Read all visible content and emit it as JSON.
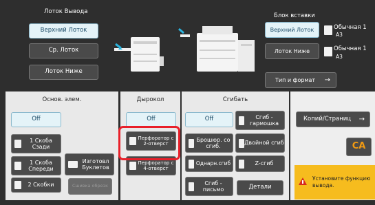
{
  "output_tray": {
    "title": "Лоток Вывода",
    "upper_tray": "Верхний Лоток",
    "middle_tray": "Ср. Лоток",
    "lower_tray": "Лоток Ниже"
  },
  "insert_unit": {
    "title": "Блок вставки",
    "upper_tray": "Верхний Лоток",
    "lower_tray": "Лоток Ниже",
    "upper_paper_type": "Обычная 1",
    "upper_paper_size": "A3",
    "lower_paper_type": "Обычная 1",
    "lower_paper_size": "A3",
    "type_size_button": "Тип и формат",
    "type_size_arrow": "→"
  },
  "basic": {
    "header": "Основ. элем.",
    "off": "Off",
    "staple_back": "1 Скоба Сзади",
    "staple_front": "1 Скоба Спереди",
    "staple_two": "2 Скобки",
    "booklet": "Изготовл Буклетов",
    "disabled": "Сшивка обрезк"
  },
  "punch": {
    "header": "Дырокол",
    "off": "Off",
    "two_hole": "Перфоратор с 2-отверст",
    "four_hole": "Перфоратор с 4-отверст"
  },
  "fold": {
    "header": "Сгибать",
    "off": "Off",
    "accordion": "Сгиб - гармошка",
    "saddle": "Брошюр. со сгиб.",
    "double": "Двойной сгиб",
    "single": "Однарн.сгиб",
    "z_fold": "Z-сгиб",
    "letter": "Сгиб - письмо",
    "details": "Детали"
  },
  "copies": {
    "label": "Копий/Страниц",
    "arrow": "→"
  },
  "ca_button": "CA",
  "warning": {
    "icon": "warning-icon",
    "text": "Установите функцию вывода."
  },
  "colors": {
    "accent": "#2a9fd6",
    "selected_bg": "#e4f3f8",
    "warning_bg": "#f6bc1e",
    "ca": "#f19a12",
    "highlight": "#e8202a"
  }
}
